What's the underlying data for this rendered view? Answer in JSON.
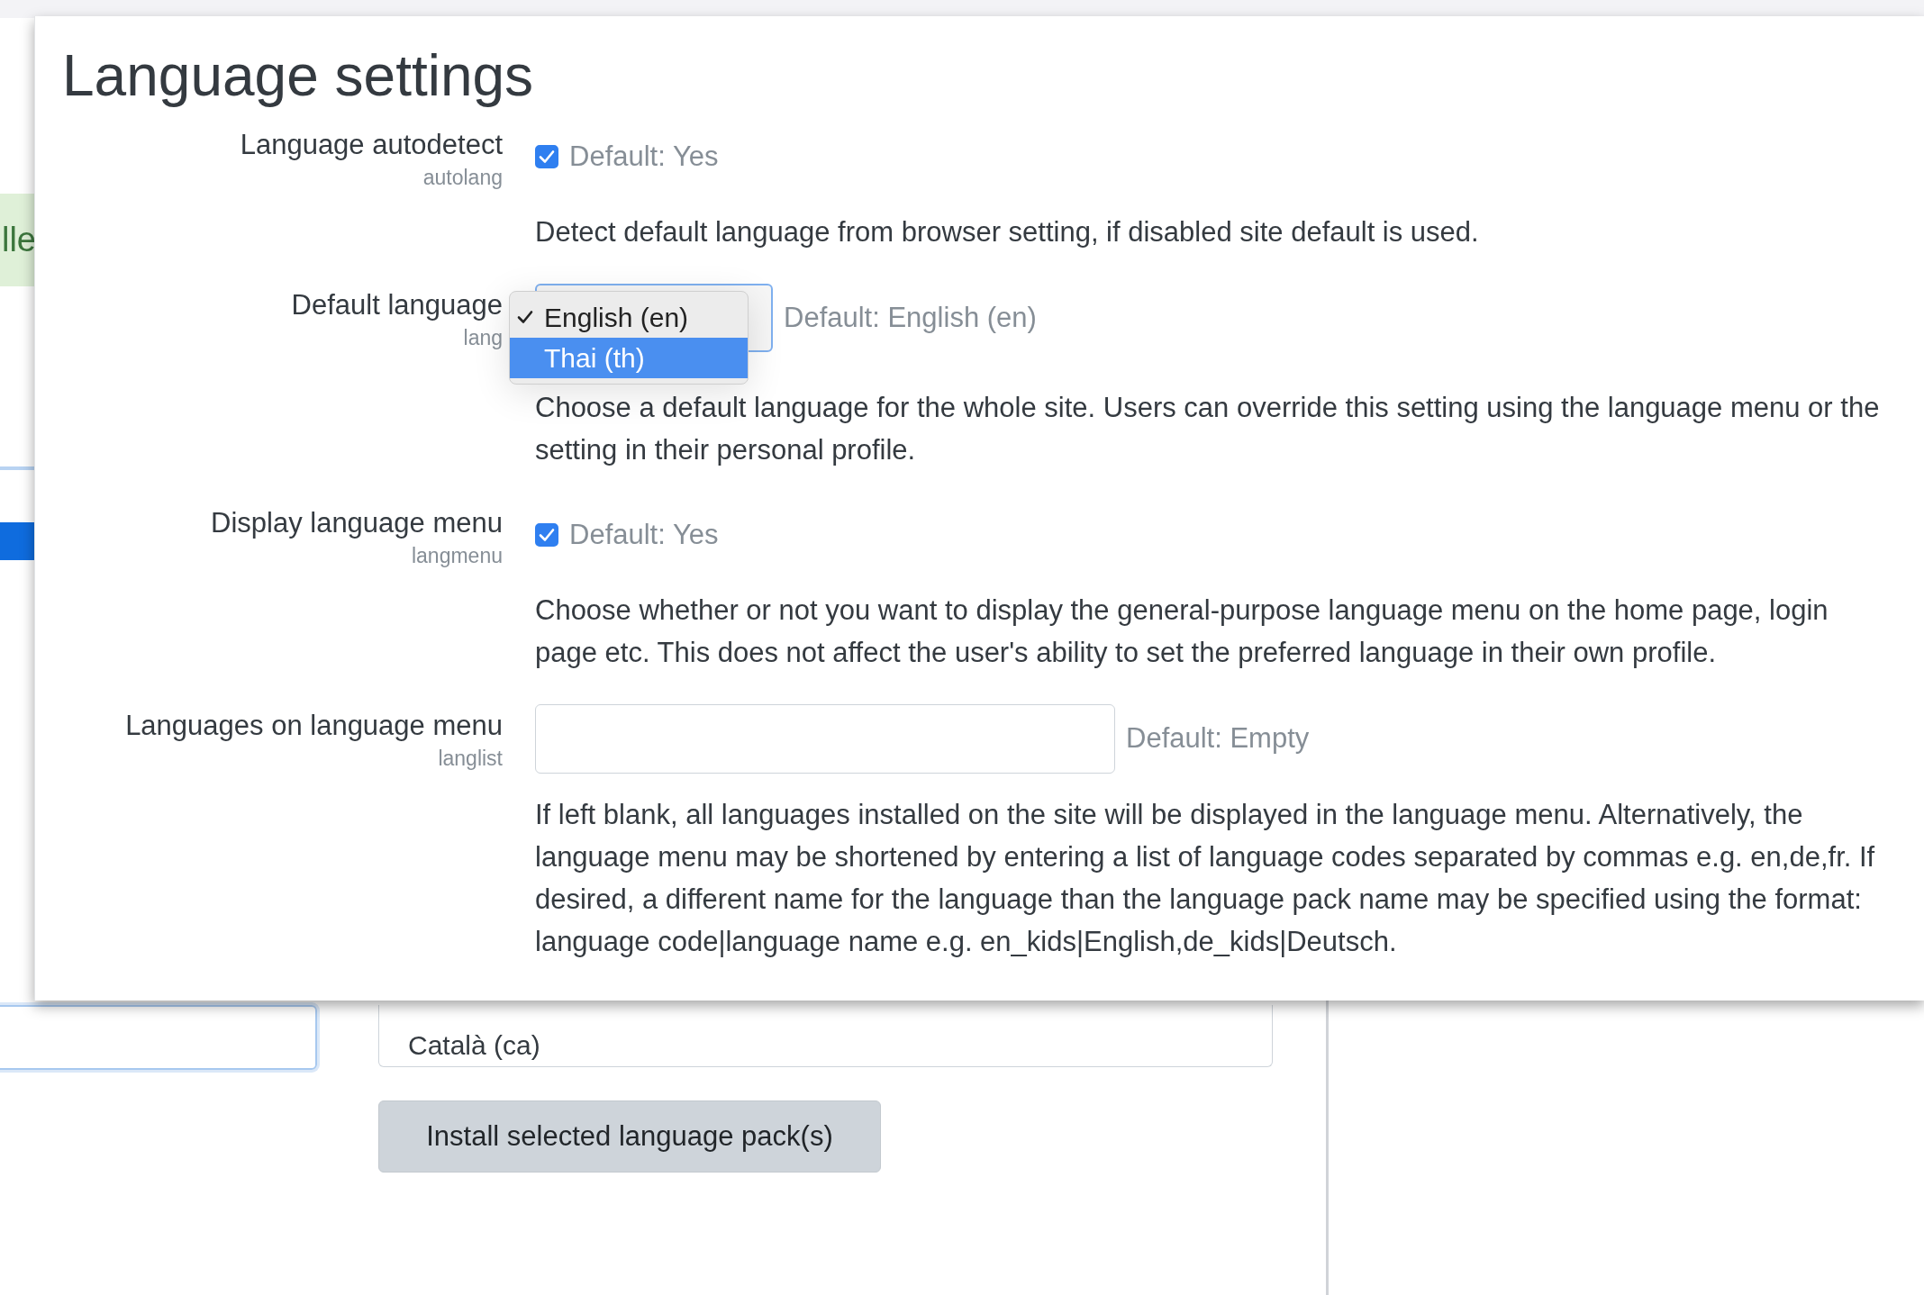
{
  "title": "Language settings",
  "settings": [
    {
      "kind": "checkbox",
      "label": "Language autodetect",
      "name": "autolang",
      "checked": true,
      "default": "Default: Yes",
      "description": "Detect default language from browser setting, if disabled site default is used."
    },
    {
      "kind": "select",
      "label": "Default language",
      "name": "lang",
      "options": [
        {
          "label": "English (en)",
          "checked": true,
          "selected": false
        },
        {
          "label": "Thai (th)",
          "checked": false,
          "selected": true
        }
      ],
      "default": "Default: English (en)",
      "description": "Choose a default language for the whole site. Users can override this setting using the language menu or the setting in their personal profile."
    },
    {
      "kind": "checkbox",
      "label": "Display language menu",
      "name": "langmenu",
      "checked": true,
      "default": "Default: Yes",
      "description": "Choose whether or not you want to display the general-purpose language menu on the home page, login page etc. This does not affect the user's ability to set the preferred language in their own profile."
    },
    {
      "kind": "text",
      "label": "Languages on language menu",
      "name": "langlist",
      "default": "Default: Empty",
      "description": "If left blank, all languages installed on the site will be displayed in the language menu. Alternatively, the language menu may be shortened by entering a list of language codes separated by commas e.g. en,de,fr. If desired, a different name for the language than the language pack name may be specified using the format: language code|language name e.g. en_kids|English,de_kids|Deutsch."
    }
  ],
  "background": {
    "alert_fragment": "lle",
    "listbox_items": [
      "Català (ca)"
    ],
    "install_button": "Install selected language pack(s)"
  }
}
